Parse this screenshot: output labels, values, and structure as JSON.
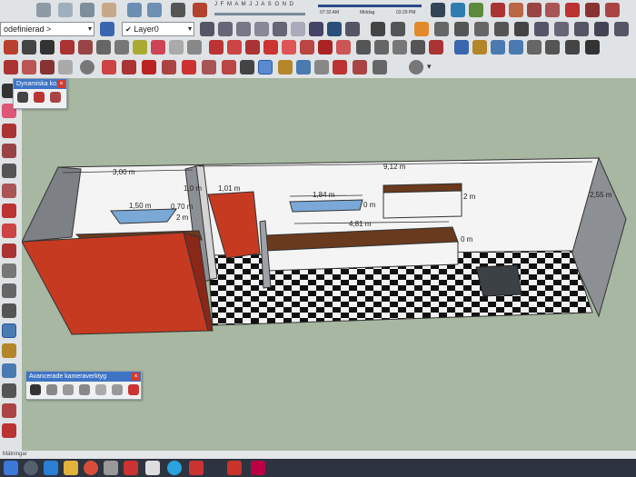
{
  "toolbar": {
    "style_dropdown": "odefinierad >",
    "layer_dropdown": "Layer0",
    "months": "J F M A M J J A S O N D",
    "time_start": "07:33 AM",
    "time_mid": "Middag",
    "time_end": "03:29 PM"
  },
  "panels": {
    "dynamic": {
      "title": "Dynamiska ko..."
    },
    "camera": {
      "title": "Avancerade kameraverktyg"
    }
  },
  "status": {
    "text": "Mätningar"
  },
  "model": {
    "dims": [
      "3,00 m",
      "9,12 m",
      "1,01 m",
      "1,84 m",
      "1,50 m",
      "0,70 m",
      "4,81 m",
      "2,55 m",
      "2 m",
      "0 m",
      "0 m",
      "2 m",
      "1,0 m"
    ],
    "colors": {
      "red_wall": "#c63a22",
      "counter": "#6a3a1e",
      "floor_dark": "#111111",
      "floor_light": "#f2f2f2",
      "window": "#7aa9d8"
    }
  }
}
